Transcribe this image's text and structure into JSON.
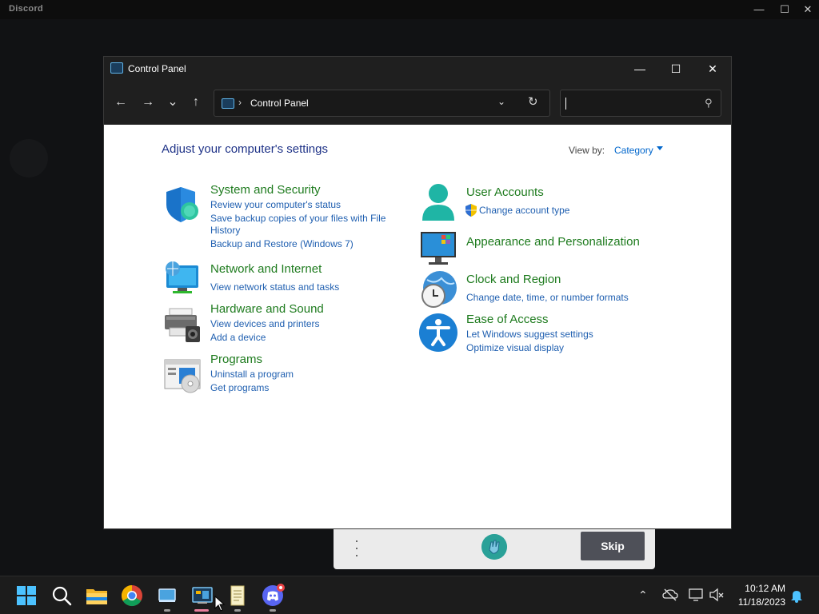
{
  "discord": {
    "title": "Discord",
    "min_glyph": "—",
    "max_glyph": "☐",
    "close_glyph": "✕",
    "skip_label": "Skip"
  },
  "window": {
    "title": "Control Panel",
    "min_glyph": "—",
    "max_glyph": "☐",
    "close_glyph": "✕"
  },
  "toolbar": {
    "back_glyph": "←",
    "forward_glyph": "→",
    "recent_glyph": "⌄",
    "up_glyph": "↑",
    "address_sep": "›",
    "address_text": "Control Panel",
    "address_dropdown_glyph": "⌄",
    "refresh_glyph": "↻",
    "search_value": "",
    "search_glyph": "⚲"
  },
  "content": {
    "heading": "Adjust your computer's settings",
    "view_by_label": "View by:",
    "view_by_value": "Category",
    "categories": [
      {
        "title": "System and Security",
        "links": [
          "Review your computer's status",
          "Save backup copies of your files with File History",
          "Backup and Restore (Windows 7)"
        ],
        "icon": "shield-icon"
      },
      {
        "title": "Network and Internet",
        "links": [
          "View network status and tasks"
        ],
        "icon": "network-icon"
      },
      {
        "title": "Hardware and Sound",
        "links": [
          "View devices and printers",
          "Add a device"
        ],
        "icon": "printer-icon"
      },
      {
        "title": "Programs",
        "links": [
          "Uninstall a program",
          "Get programs"
        ],
        "icon": "programs-icon"
      },
      {
        "title": "User Accounts",
        "links": [
          "Change account type"
        ],
        "icon": "user-icon"
      },
      {
        "title": "Appearance and Personalization",
        "links": [],
        "icon": "monitor-icon"
      },
      {
        "title": "Clock and Region",
        "links": [
          "Change date, time, or number formats"
        ],
        "icon": "clock-globe-icon"
      },
      {
        "title": "Ease of Access",
        "links": [
          "Let Windows suggest settings",
          "Optimize visual display"
        ],
        "icon": "accessibility-icon"
      }
    ]
  },
  "taskbar": {
    "apps": [
      "start-icon",
      "search-icon",
      "file-explorer-icon",
      "chrome-icon",
      "app-window-icon",
      "control-panel-icon",
      "notepad-icon",
      "discord-icon"
    ],
    "tray_chevron": "⌃",
    "time": "10:12 AM",
    "date": "11/18/2023"
  },
  "colors": {
    "link": "#1f5fb0",
    "category_title": "#1e7b1e",
    "heading": "#1e3287",
    "titlebar": "#1f1f1f"
  }
}
